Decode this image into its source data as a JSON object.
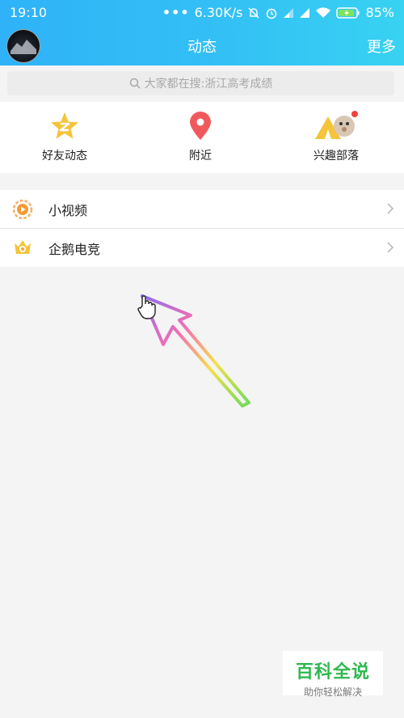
{
  "status_bar": {
    "time": "19:10",
    "network_speed": "6.30K/s",
    "battery": "85%",
    "icons": [
      "more-dots-icon",
      "mute-icon",
      "alarm-icon",
      "signal-icon",
      "signal-icon",
      "wifi-icon",
      "battery-charging-icon"
    ]
  },
  "navbar": {
    "title": "动态",
    "more_label": "更多",
    "avatar": "avatar"
  },
  "search": {
    "placeholder": "大家都在搜:浙江高考成绩",
    "icon": "search-icon"
  },
  "quick_actions": [
    {
      "label": "好友动态",
      "icon": "star-icon",
      "color": "#f5c43b"
    },
    {
      "label": "附近",
      "icon": "location-pin-icon",
      "color": "#f0595b"
    },
    {
      "label": "兴趣部落",
      "icon": "tent-icon",
      "color": "#f5c43b",
      "badge": "red-dot"
    }
  ],
  "list": [
    {
      "label": "小视频",
      "icon": "video-play-icon",
      "color": "#f59a33"
    },
    {
      "label": "企鹅电竞",
      "icon": "esports-crown-icon",
      "color": "#f5c43b"
    }
  ],
  "watermark": {
    "title": "百科全说",
    "subtitle": "助你轻松解决"
  },
  "colors": {
    "header_gradient": [
      "#2fb2f8",
      "#38d2f2"
    ],
    "background": "#f4f4f4"
  }
}
